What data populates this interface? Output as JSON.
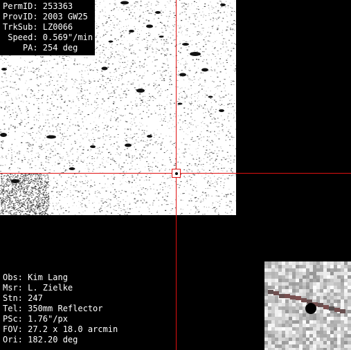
{
  "object_info": {
    "perm_id": "PermID: 253363",
    "prov_id": "ProvID: 2003 GW25",
    "trk_sub": "TrkSub: LZ0066",
    "speed": " Speed: 0.569\"/min",
    "pa": "    PA: 254 deg"
  },
  "observation_info": {
    "obs": "Obs: Kim Lang",
    "msr": "Msr: L. Zielke",
    "stn": "Stn: 247",
    "tel": "Tel: 350mm Reflector",
    "psc": "PSc: 1.76\"/px",
    "fov": "FOV: 27.2 x 18.0 arcmin",
    "ori": "Ori: 182.20 deg"
  },
  "colors": {
    "crosshair": "#e01010",
    "background": "#000000",
    "field": "#ffffff",
    "text": "#ffffff"
  }
}
